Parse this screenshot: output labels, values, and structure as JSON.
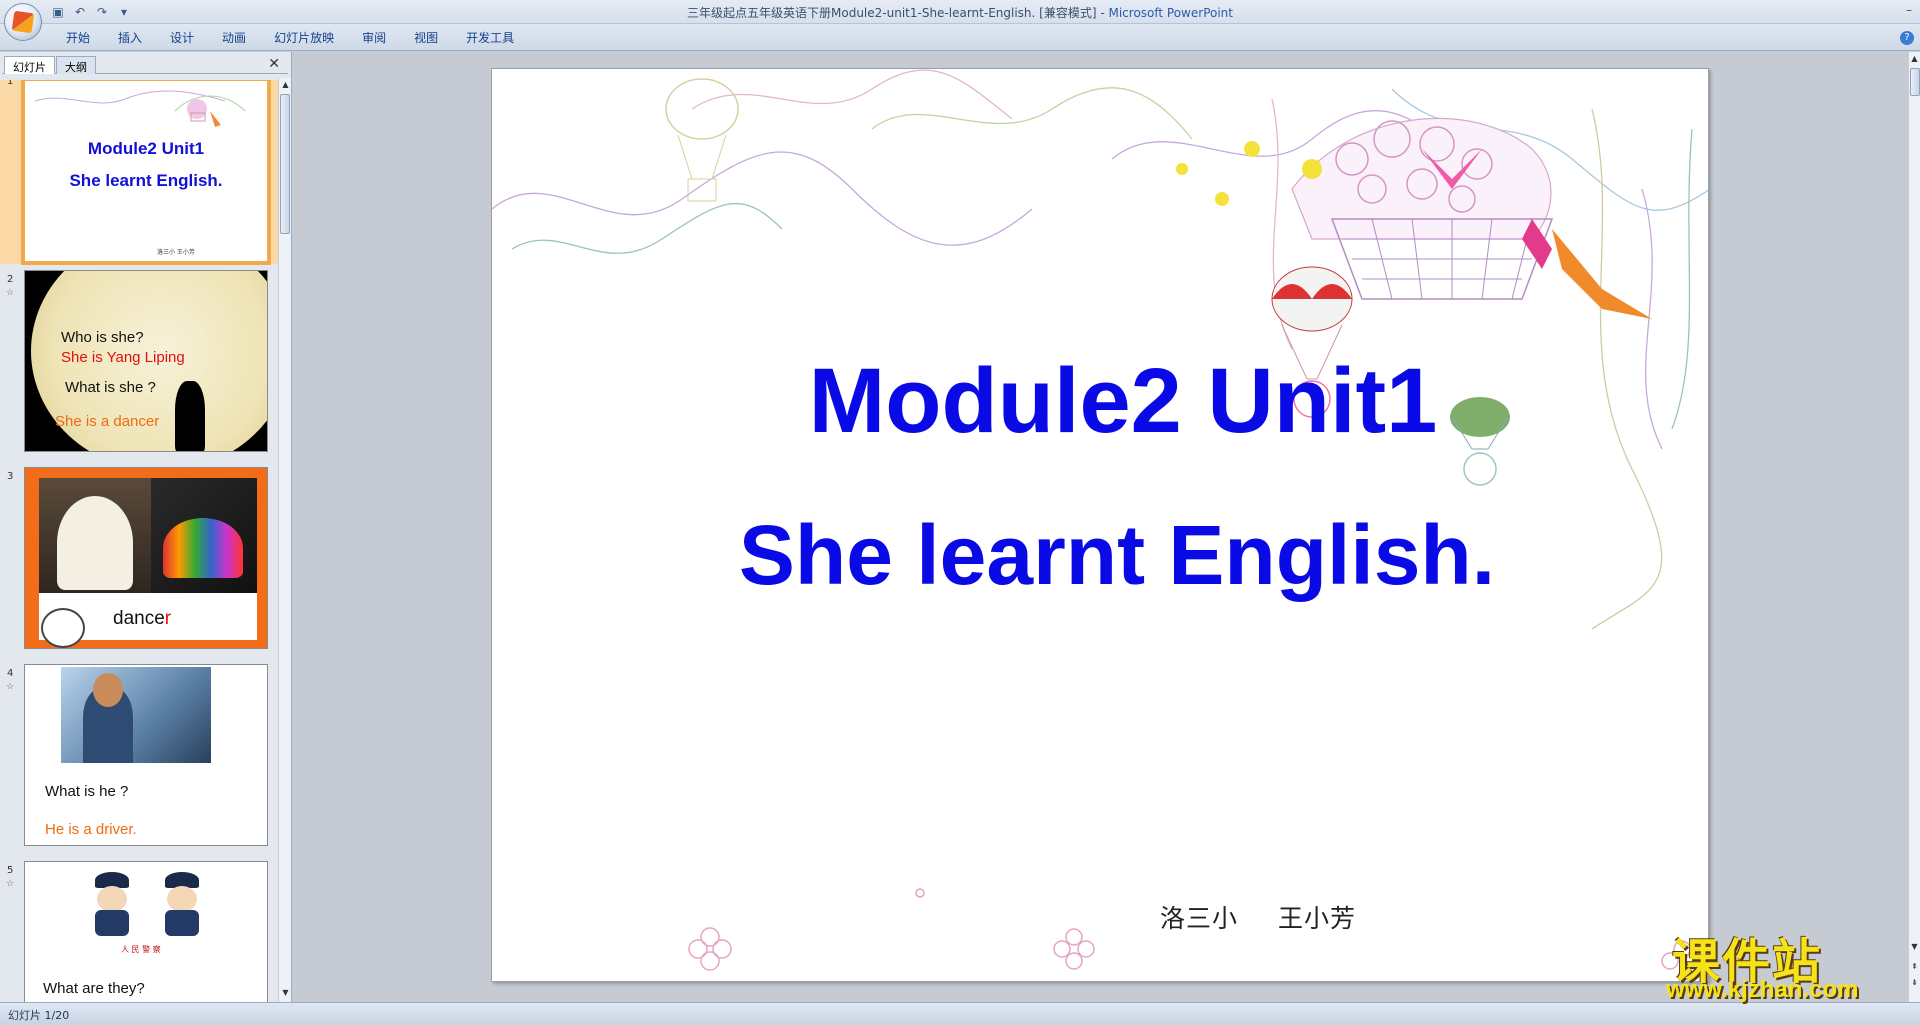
{
  "window": {
    "title": "三年级起点五年级英语下册Module2-unit1-She-learnt-English. [兼容模式] - ",
    "app_name": "Microsoft PowerPoint"
  },
  "ribbon": {
    "tabs": [
      "开始",
      "插入",
      "设计",
      "动画",
      "幻灯片放映",
      "审阅",
      "视图",
      "开发工具"
    ]
  },
  "left_panel": {
    "tabs": [
      "幻灯片",
      "大纲"
    ],
    "thumbnails": [
      {
        "number": "1",
        "title": "Module2 Unit1",
        "subtitle": "She learnt English.",
        "author": "洛三小   王小芳"
      },
      {
        "number": "2",
        "lines": [
          "Who is she?",
          "She is Yang Liping",
          "What is she ?",
          "She is a dancer"
        ]
      },
      {
        "number": "3",
        "word": "dance",
        "word_suffix": "r"
      },
      {
        "number": "4",
        "lines": [
          "What is he ?",
          "He is a driver."
        ]
      },
      {
        "number": "5",
        "sign": "人 民 警 察",
        "lines": [
          "What  are they?"
        ]
      }
    ]
  },
  "slide": {
    "title": "Module2 Unit1",
    "subtitle": "She learnt English.",
    "author_school": "洛三小",
    "author_name": "王小芳"
  },
  "status": {
    "slide_counter": "幻灯片 1/20"
  },
  "watermark": {
    "chinese": "课件站",
    "url": "www.kjzhan.com"
  },
  "colors": {
    "title_blue": "#0a0ae6",
    "selection_orange": "#f2a94a",
    "accent_orange": "#f06a10",
    "accent_red": "#e01010"
  }
}
